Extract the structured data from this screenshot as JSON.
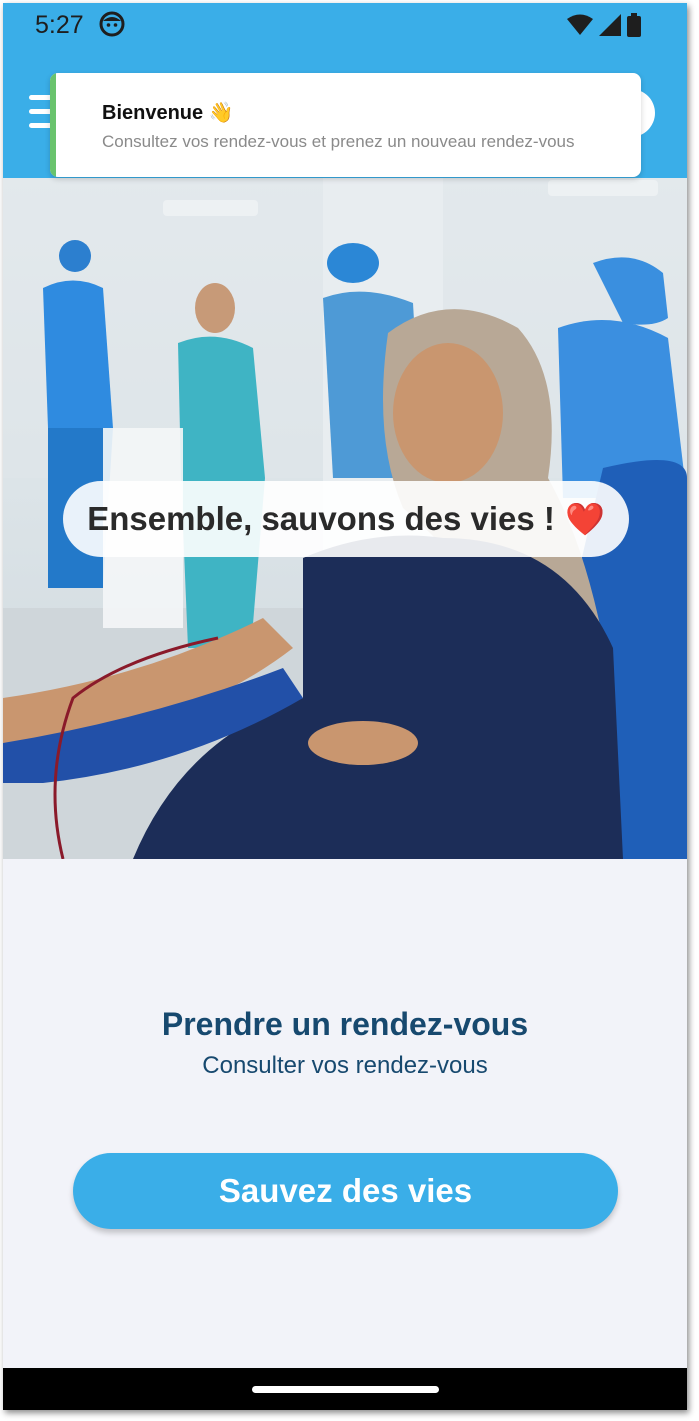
{
  "status_bar": {
    "time": "5:27",
    "icons": [
      "face-icon",
      "wifi-icon",
      "signal-icon",
      "battery-icon"
    ]
  },
  "app_bar": {
    "menu_icon": "menu-icon",
    "profile_icon": "profile-icon"
  },
  "toast": {
    "title": "Bienvenue 👋",
    "message": "Consultez vos rendez-vous et prenez un nouveau rendez-vous",
    "accent_color": "#69c36d"
  },
  "hero": {
    "caption": "Ensemble, sauvons des vies !",
    "heart": "❤️"
  },
  "content": {
    "title": "Prendre un rendez-vous",
    "subtitle": "Consulter vos rendez-vous",
    "cta_label": "Sauvez des vies"
  },
  "colors": {
    "primary": "#3aaee8",
    "heading": "#17496f",
    "background": "#f2f3f9"
  }
}
